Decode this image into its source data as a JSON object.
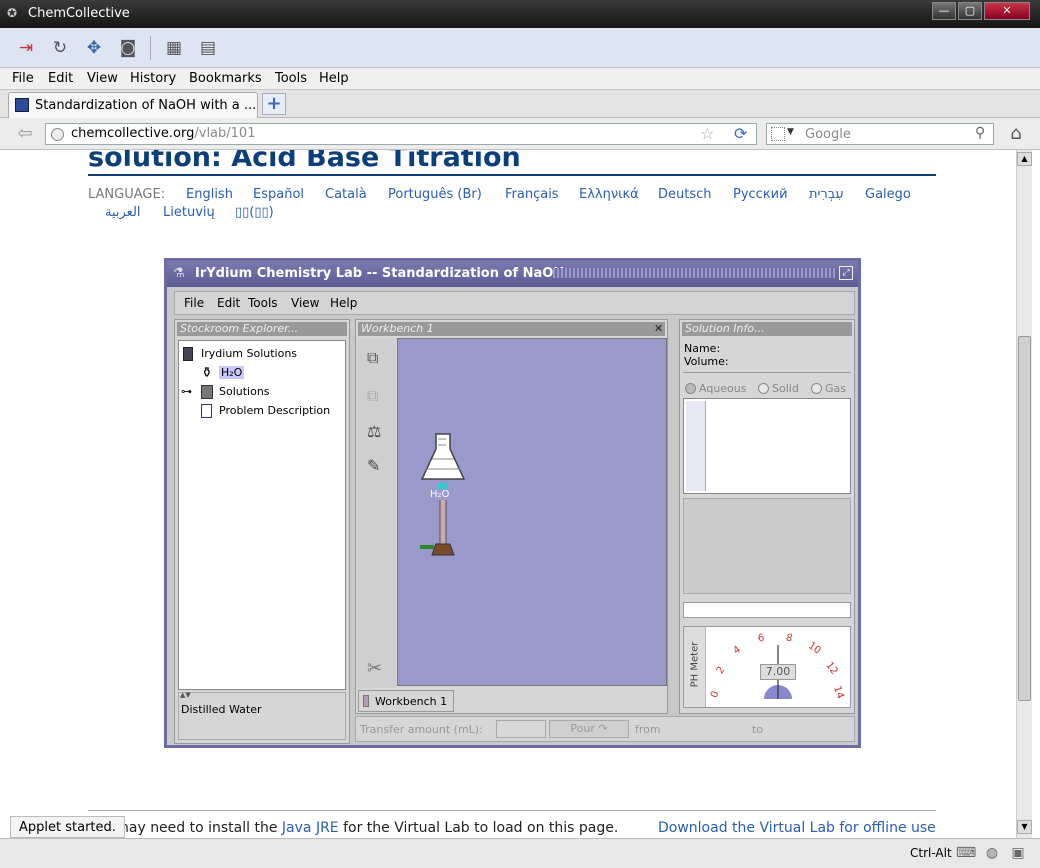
{
  "window": {
    "title": "ChemCollective",
    "buttons": [
      "—",
      "▢",
      "✕"
    ]
  },
  "menubar": [
    "File",
    "Edit",
    "View",
    "History",
    "Bookmarks",
    "Tools",
    "Help"
  ],
  "tab": {
    "title": "Standardization of NaOH with a ...",
    "newtab": "+"
  },
  "url": {
    "domain": "chemcollective.org",
    "path": "/vlab/101",
    "search_placeholder": "Google"
  },
  "page": {
    "heading": "solution: Acid Base Titration",
    "language_label": "LANGUAGE:",
    "languages_row1": [
      "English",
      "Español",
      "Català",
      "Português (Br)",
      "Français",
      "Ελληνικά",
      "Deutsch",
      "Русский",
      "עִבְרִית",
      "Galego"
    ],
    "languages_row2": [
      "العربية",
      "Lietuvių",
      "▯▯(▯▯)"
    ],
    "footer_text_pre": "nay need to install the ",
    "footer_link": "Java JRE",
    "footer_text_post": " for the Virtual Lab to load on this page.",
    "footer_download": "Download the Virtual Lab for offline use",
    "applet_status": "Applet started."
  },
  "applet": {
    "title": "IrYdium Chemistry Lab -- Standardization of NaOH",
    "menu": [
      "File",
      "Edit",
      "Tools",
      "View",
      "Help"
    ],
    "stockroom": {
      "header": "Stockroom Explorer...",
      "root": "Irydium Solutions",
      "items": [
        "H₂O",
        "Solutions",
        "Problem Description"
      ],
      "description": "Distilled Water"
    },
    "workbench": {
      "header": "Workbench 1",
      "tab": "Workbench 1",
      "flask_label": "H₂O"
    },
    "solution_info": {
      "header": "Solution Info...",
      "name_label": "Name:",
      "volume_label": "Volume:",
      "radios": [
        "Aqueous",
        "Solid",
        "Gas"
      ]
    },
    "ph_meter": {
      "label": "PH Meter",
      "value": "7.00",
      "scale": [
        "0",
        "2",
        "4",
        "6",
        "8",
        "10",
        "12",
        "14"
      ]
    },
    "transfer": {
      "label": "Transfer amount (mL):",
      "pour": "Pour",
      "from": "from",
      "to": "to"
    }
  },
  "statusbar": {
    "ctrl": "Ctrl-Alt"
  }
}
